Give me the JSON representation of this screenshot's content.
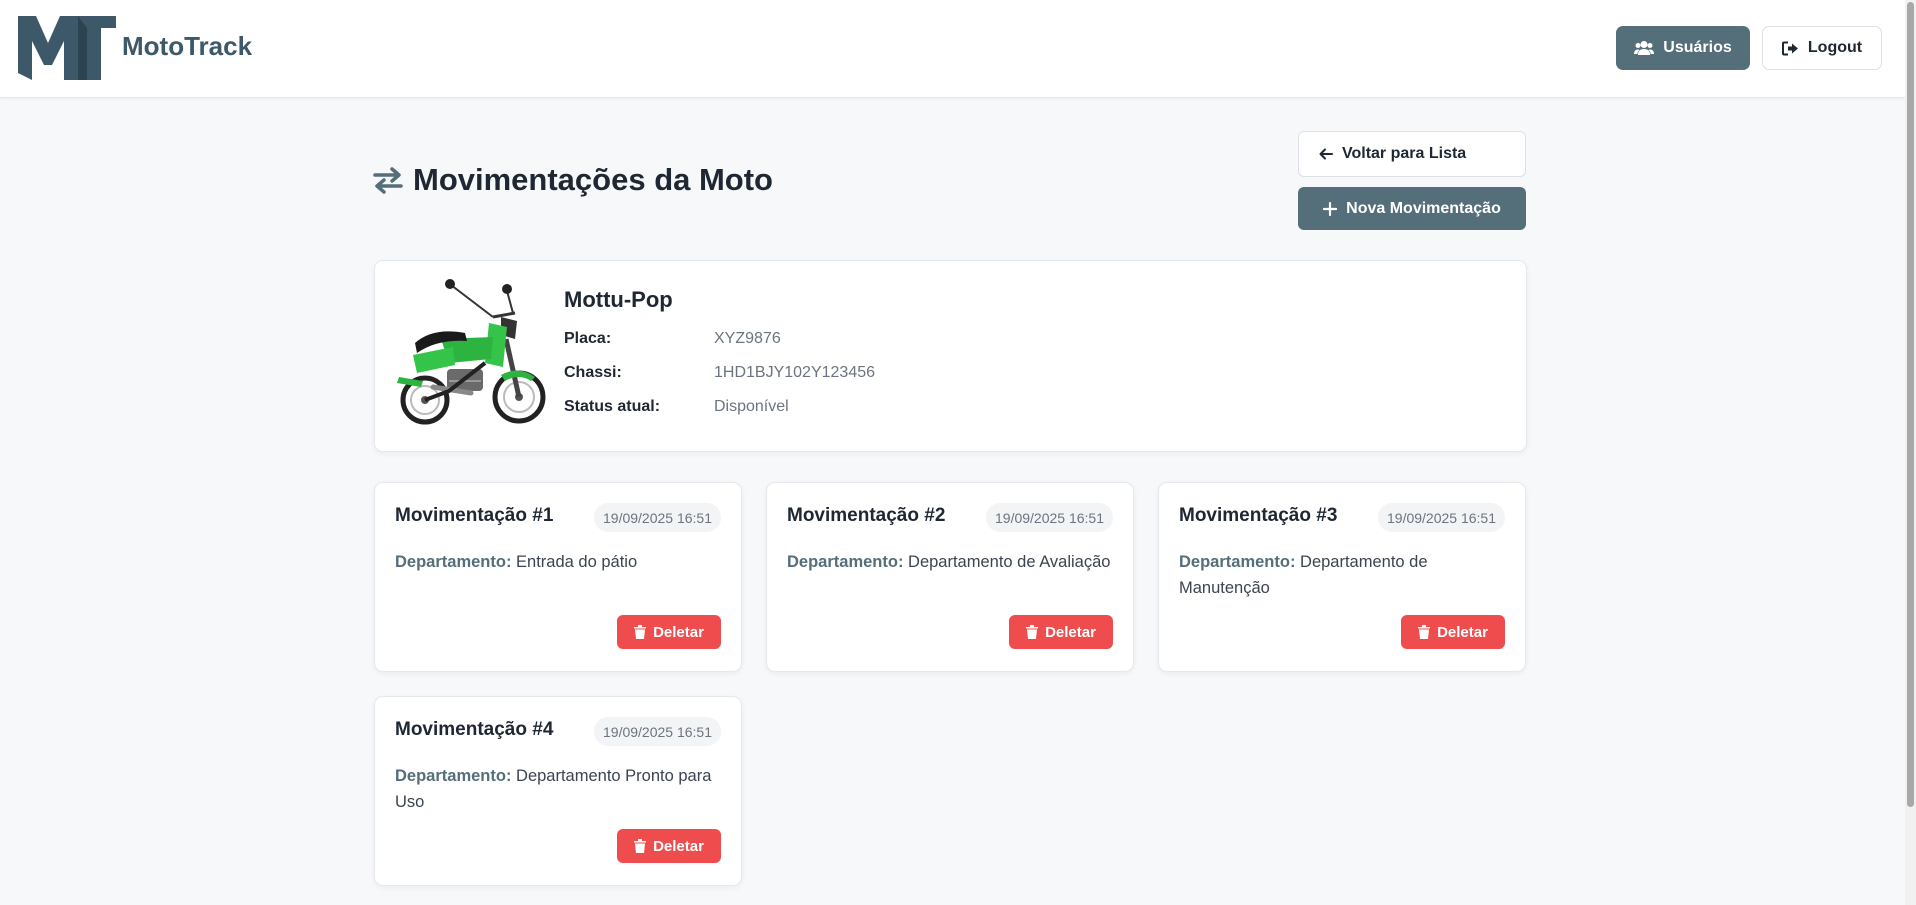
{
  "app": {
    "brand": "MotoTrack"
  },
  "header": {
    "users_label": "Usuários",
    "logout_label": "Logout"
  },
  "page": {
    "title": "Movimentações da Moto",
    "back_label": "Voltar para Lista",
    "new_label": "Nova Movimentação"
  },
  "moto": {
    "name": "Mottu-Pop",
    "fields": [
      {
        "label": "Placa:",
        "value": "XYZ9876"
      },
      {
        "label": "Chassi:",
        "value": "1HD1BJY102Y123456"
      },
      {
        "label": "Status atual:",
        "value": "Disponível"
      }
    ]
  },
  "movimentacoes": [
    {
      "title": "Movimentação #1",
      "date": "19/09/2025 16:51",
      "dept_label": "Departamento:",
      "dept": "Entrada do pátio",
      "delete_label": "Deletar"
    },
    {
      "title": "Movimentação #2",
      "date": "19/09/2025 16:51",
      "dept_label": "Departamento:",
      "dept": "Departamento de Avaliação",
      "delete_label": "Deletar"
    },
    {
      "title": "Movimentação #3",
      "date": "19/09/2025 16:51",
      "dept_label": "Departamento:",
      "dept": "Departamento de Manutenção",
      "delete_label": "Deletar"
    },
    {
      "title": "Movimentação #4",
      "date": "19/09/2025 16:51",
      "dept_label": "Departamento:",
      "dept": "Departamento Pronto para Uso",
      "delete_label": "Deletar"
    }
  ],
  "colors": {
    "primary": "#546e7a",
    "danger": "#ef4d4d",
    "logo": "#3d5868"
  },
  "icons": {
    "logo": "mt-logo-icon",
    "users": "users-icon",
    "logout": "logout-icon",
    "title": "exchange-arrows-icon",
    "back": "arrow-left-icon",
    "new": "plus-icon",
    "delete": "trash-icon"
  }
}
